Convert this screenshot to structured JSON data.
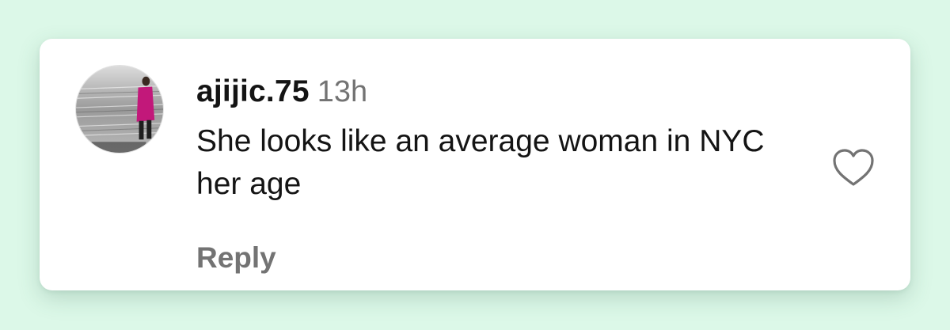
{
  "comment": {
    "username": "ajijic.75",
    "timestamp": "13h",
    "text": "She looks like an average woman in NYC her age",
    "reply_label": "Reply"
  },
  "icons": {
    "like": "heart-outline-icon",
    "avatar": "profile-photo"
  },
  "colors": {
    "page_background": "#dcf8e8",
    "card_background": "#ffffff",
    "primary_text": "#141414",
    "secondary_text": "#737373",
    "avatar_figure": "#c2187a"
  }
}
